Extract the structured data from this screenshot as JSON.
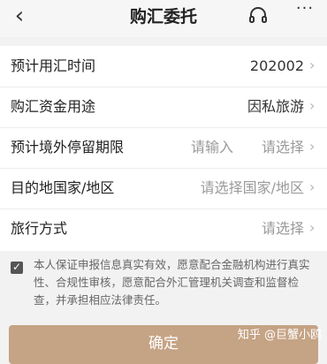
{
  "header": {
    "back_glyph": "‹",
    "title": "购汇委托",
    "support_icon": "headset-icon",
    "more_glyph": "···"
  },
  "form": {
    "rows": [
      {
        "label": "预计用汇时间",
        "value": "202002"
      },
      {
        "label": "购汇资金用途",
        "value": "因私旅游"
      },
      {
        "label": "预计境外停留期限",
        "input_placeholder": "请输入",
        "value": "请选择"
      },
      {
        "label": "目的地国家/地区",
        "value": "请选择国家/地区"
      },
      {
        "label": "旅行方式",
        "value": "请选择"
      }
    ]
  },
  "agreement": {
    "checked": true,
    "text": "本人保证申报信息真实有效，愿意配合金融机构进行真实性、合规性审核，愿意配合外汇管理机关调查和监督检查，并承担相应法律责任。"
  },
  "confirm_button": {
    "label": "确定"
  },
  "watermark": "知乎 @巨蟹小鸥",
  "colors": {
    "primary_button": "#c5a385",
    "background": "#f2f2f2",
    "placeholder": "#9a9a9a"
  }
}
